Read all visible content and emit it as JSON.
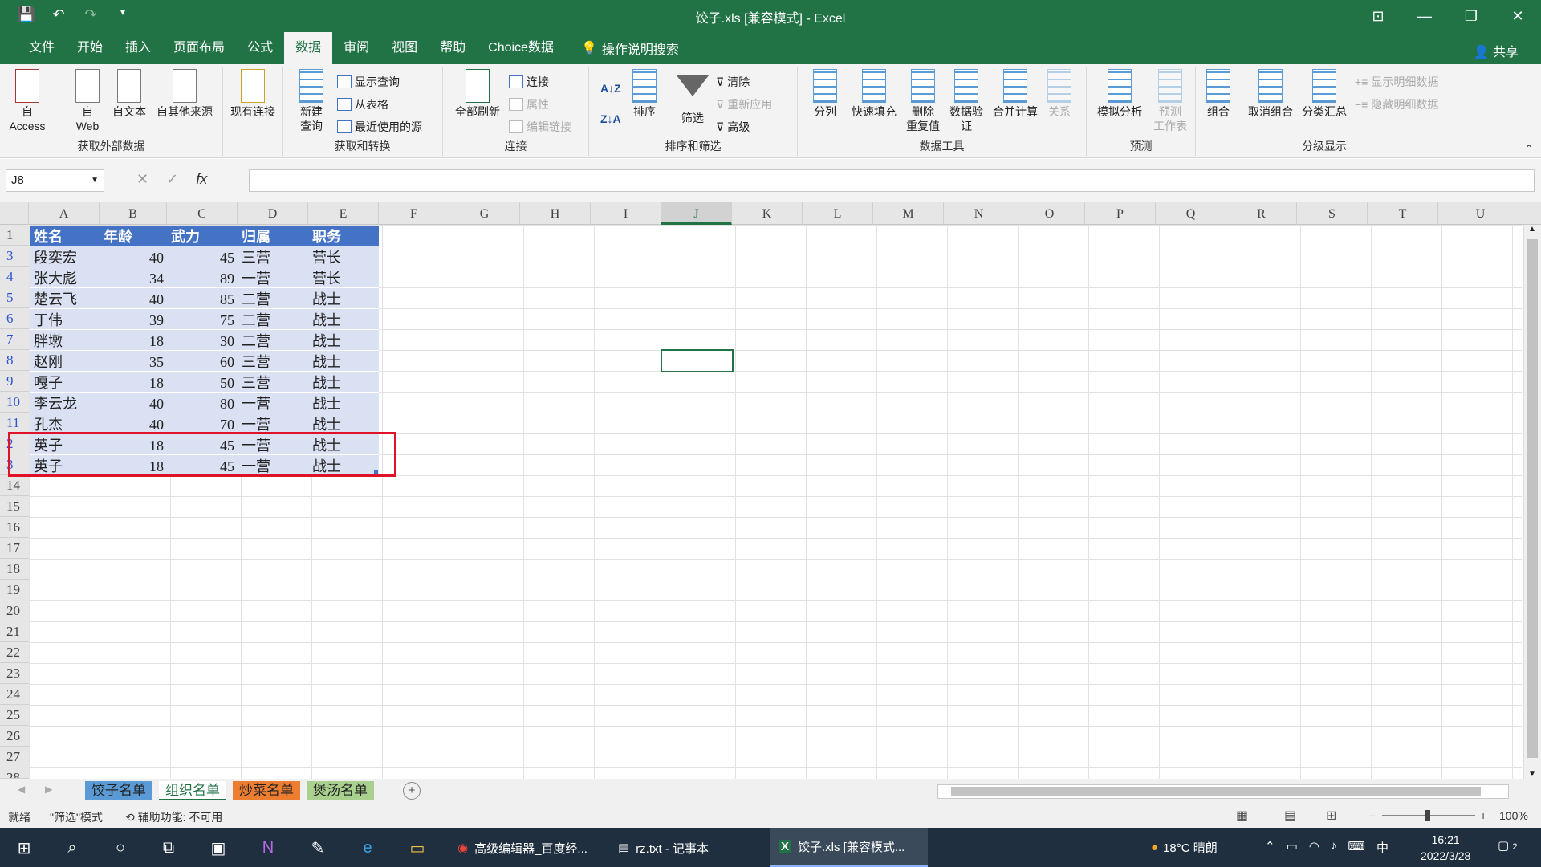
{
  "window": {
    "title": "饺子.xls  [兼容模式]  -  Excel"
  },
  "tabs": [
    "文件",
    "开始",
    "插入",
    "页面布局",
    "公式",
    "数据",
    "审阅",
    "视图",
    "帮助",
    "Choice数据"
  ],
  "active_tab": "数据",
  "search_label": "操作说明搜索",
  "share_label": "共享",
  "ribbon": {
    "g1": {
      "label": "获取外部数据",
      "access": "自 Access",
      "web1": "自",
      "web2": "Web",
      "text": "自文本",
      "other": "自其他来源"
    },
    "existing": "现有连接",
    "g2": {
      "label": "获取和转换",
      "newq1": "新建",
      "newq2": "查询",
      "show": "显示查询",
      "fromtable": "从表格",
      "recent": "最近使用的源"
    },
    "g3": {
      "label": "连接",
      "refresh": "全部刷新",
      "conn": "连接",
      "props": "属性",
      "editlinks": "编辑链接"
    },
    "g4": {
      "label": "排序和筛选",
      "sort": "排序",
      "filter": "筛选",
      "clear": "清除",
      "reapply": "重新应用",
      "advanced": "高级"
    },
    "g5": {
      "label": "数据工具",
      "split": "分列",
      "flash": "快速填充",
      "dup1": "删除",
      "dup2": "重复值",
      "valid1": "数据验",
      "valid2": "证",
      "consolidate": "合并计算",
      "relations": "关系"
    },
    "g6": {
      "label": "预测",
      "whatif": "模拟分析",
      "forecast1": "预测",
      "forecast2": "工作表"
    },
    "g7": {
      "label": "分级显示",
      "group": "组合",
      "ungroup": "取消组合",
      "subtotal": "分类汇总",
      "showdetail": "显示明细数据",
      "hidedetail": "隐藏明细数据"
    }
  },
  "namebox": "J8",
  "columns": [
    "A",
    "B",
    "C",
    "D",
    "E",
    "F",
    "G",
    "H",
    "I",
    "J",
    "K",
    "L",
    "M",
    "N",
    "O",
    "P",
    "Q",
    "R",
    "S",
    "T",
    "U"
  ],
  "rows": [
    "1",
    "3",
    "4",
    "5",
    "6",
    "7",
    "8",
    "9",
    "10",
    "11",
    "2",
    "3",
    "14",
    "15",
    "16",
    "17",
    "18",
    "19",
    "20",
    "21",
    "22",
    "23",
    "24",
    "25",
    "26",
    "27",
    "28"
  ],
  "table": {
    "headers": [
      "姓名",
      "年龄",
      "武力",
      "归属",
      "职务"
    ],
    "data": [
      [
        "段奕宏",
        "40",
        "45",
        "三营",
        "营长"
      ],
      [
        "张大彪",
        "34",
        "89",
        "一营",
        "营长"
      ],
      [
        "楚云飞",
        "40",
        "85",
        "二营",
        "战士"
      ],
      [
        "丁伟",
        "39",
        "75",
        "二营",
        "战士"
      ],
      [
        "胖墩",
        "18",
        "30",
        "二营",
        "战士"
      ],
      [
        "赵刚",
        "35",
        "60",
        "三营",
        "战士"
      ],
      [
        "嘎子",
        "18",
        "50",
        "三营",
        "战士"
      ],
      [
        "李云龙",
        "40",
        "80",
        "一营",
        "战士"
      ],
      [
        "孔杰",
        "40",
        "70",
        "一营",
        "战士"
      ],
      [
        "英子",
        "18",
        "45",
        "一营",
        "战士"
      ],
      [
        "英子",
        "18",
        "45",
        "一营",
        "战士"
      ]
    ]
  },
  "sheet_tabs": [
    {
      "name": "饺子名单",
      "color": "#5b9bd5"
    },
    {
      "name": "组织名单",
      "color": "#ffffff"
    },
    {
      "name": "炒菜名单",
      "color": "#ed7d31"
    },
    {
      "name": "煲汤名单",
      "color": "#a9d08e"
    }
  ],
  "status": {
    "ready": "就绪",
    "mode": "\"筛选\"模式",
    "access": "辅助功能: 不可用",
    "zoom": "100%"
  },
  "taskbar": {
    "chrome": "高级编辑器_百度经...",
    "notepad": "rz.txt - 记事本",
    "excel": "饺子.xls [兼容模式...",
    "weather": "18°C  晴朗",
    "ime": "中",
    "time": "16:21",
    "date": "2022/3/28",
    "notif": "2"
  },
  "colors": {
    "accent": "#217346",
    "header_fill": "#4472c4",
    "band_fill": "#d9e1f2",
    "highlight": "#e0122a"
  }
}
